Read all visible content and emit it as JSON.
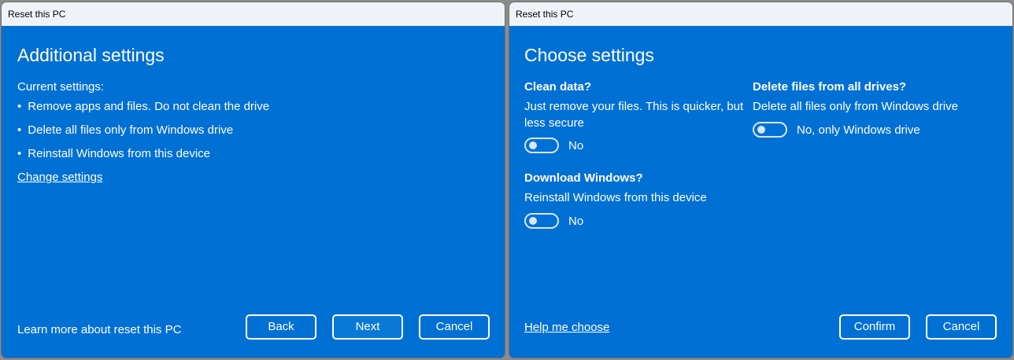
{
  "left": {
    "window_title": "Reset this PC",
    "heading": "Additional settings",
    "current_label": "Current settings:",
    "bullets": [
      "Remove apps and files. Do not clean the drive",
      "Delete all files only from Windows drive",
      "Reinstall Windows from this device"
    ],
    "change_link": "Change settings",
    "learn_more": "Learn more about reset this PC",
    "back": "Back",
    "next": "Next",
    "cancel": "Cancel"
  },
  "right": {
    "window_title": "Reset this PC",
    "heading": "Choose settings",
    "clean": {
      "title": "Clean data?",
      "desc1": "Just remove your files. This is quicker, but",
      "desc2": "less secure",
      "toggle_label": "No",
      "on": false
    },
    "download": {
      "title": "Download Windows?",
      "desc": "Reinstall Windows from this device",
      "toggle_label": "No",
      "on": false
    },
    "drives": {
      "title": "Delete files from all drives?",
      "desc": "Delete all files only from Windows drive",
      "toggle_label": "No, only Windows drive",
      "on": false
    },
    "help_link": "Help me choose",
    "confirm": "Confirm",
    "cancel": "Cancel"
  }
}
